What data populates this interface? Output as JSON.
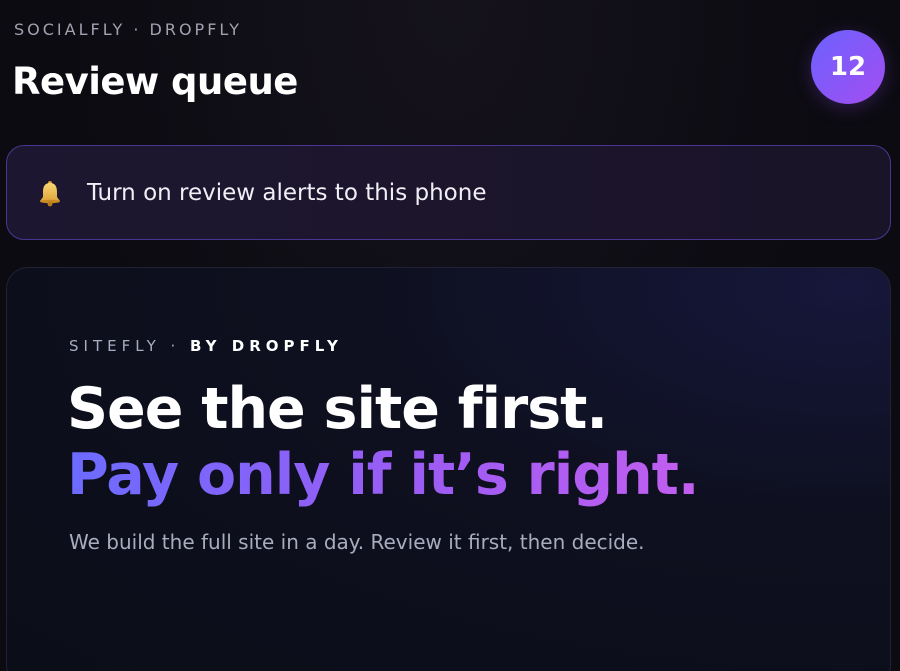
{
  "header": {
    "brand": "SOCIALFLY · DROPFLY",
    "title": "Review queue",
    "count": "12"
  },
  "alert": {
    "icon": "bell-icon",
    "text": "Turn on review alerts to this phone"
  },
  "hero": {
    "eyebrow_light": "SITEFLY · ",
    "eyebrow_strong": "BY DROPFLY",
    "headline_line1": "See the site first.",
    "headline_line2": "Pay only if it’s right.",
    "subtitle": "We build the full site in a day. Review it first, then decide."
  },
  "colors": {
    "background": "#0c0b11",
    "accent_start": "#6b62ff",
    "accent_end": "#a44df0",
    "banner_border": "#4a3592"
  }
}
